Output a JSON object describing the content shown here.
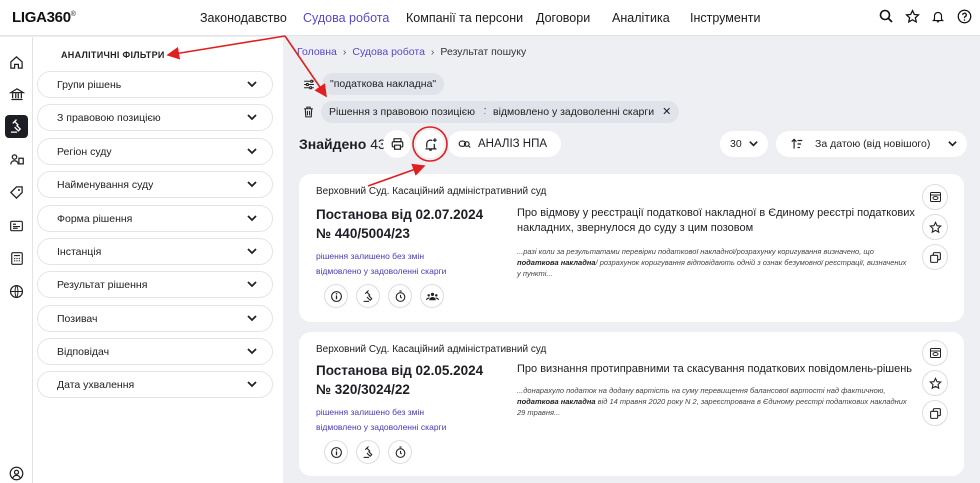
{
  "header": {
    "logo": "LIGA360",
    "logo_mark": "®",
    "nav": [
      {
        "label": "Законодавство",
        "active": false
      },
      {
        "label": "Судова робота",
        "active": true
      },
      {
        "label": "Компанії та персони",
        "active": false
      },
      {
        "label": "Договори",
        "active": false
      },
      {
        "label": "Аналітика",
        "active": false
      },
      {
        "label": "Інструменти",
        "active": false
      }
    ],
    "icons": [
      "search-icon",
      "star-icon",
      "bell-icon",
      "help-icon"
    ]
  },
  "rail": {
    "icons": [
      "home-icon",
      "bank-icon",
      "gavel-icon",
      "people-icon",
      "tag-icon",
      "id-card-icon",
      "calculator-icon",
      "globe-icon",
      "user-icon"
    ],
    "active": "gavel-icon"
  },
  "filters": {
    "title": "АНАЛІТИЧНІ ФІЛЬТРИ",
    "items": [
      "Групи рішень",
      "З правовою позицією",
      "Регіон суду",
      "Найменування суду",
      "Форма рішення",
      "Інстанція",
      "Результат рішення",
      "Позивач",
      "Відповідач",
      "Дата ухвалення"
    ]
  },
  "breadcrumb": {
    "items": [
      "Головна",
      "Судова робота",
      "Результат пошуку"
    ]
  },
  "search": {
    "query_chip": "\"податкова накладна\"",
    "filter_chips": [
      "Рішення з правовою позицією",
      "відмовлено у задоволенні скарги"
    ]
  },
  "results_bar": {
    "found_label": "Знайдено",
    "found_count": "43",
    "npa_label": "АНАЛІЗ НПА",
    "page_size": "30",
    "sort_label": "За датою (від новішого)"
  },
  "results": [
    {
      "court": "Верховний Суд. Касаційний адміністративний суд",
      "title_line1": "Постанова від 02.07.2024",
      "title_line2": "№ 440/5004/23",
      "status1": "рішення залишено без змін",
      "status2": "відмовлено у задоволенні скарги",
      "summary": "Про відмову у реєстрації податкової накладної в Єдиному реєстрі податкових накладних, звернулося до суду з цим позовом",
      "snippet_pre": "...разі коли за результатами перевірки податкової накладної/розрахунку коригування визначено, що ",
      "snippet_bold": "податкова накладна",
      "snippet_post": "/ розрахунок коригування відповідають одній з ознак безумовної реєстрації, визначених у пункті..."
    },
    {
      "court": "Верховний Суд. Касаційний адміністративний суд",
      "title_line1": "Постанова від 02.05.2024",
      "title_line2": "№ 320/3024/22",
      "status1": "рішення залишено без змін",
      "status2": "відмовлено у задоволенні скарги",
      "summary": "Про визнання протиправними та скасування податкових повідомлень-рішень",
      "snippet_pre": "...донарахуло податок на додану вартість на суму перевищення балансової вартості над фактичною, ",
      "snippet_bold": "податкова накладна",
      "snippet_post": " від 14 травня 2020 року N 2, зареєстрована в Єдиному реєстрі податкових накладних 29 травня..."
    }
  ],
  "colors": {
    "accent": "#5a47c8",
    "annotation": "#e02020",
    "background": "#eeeff2"
  }
}
